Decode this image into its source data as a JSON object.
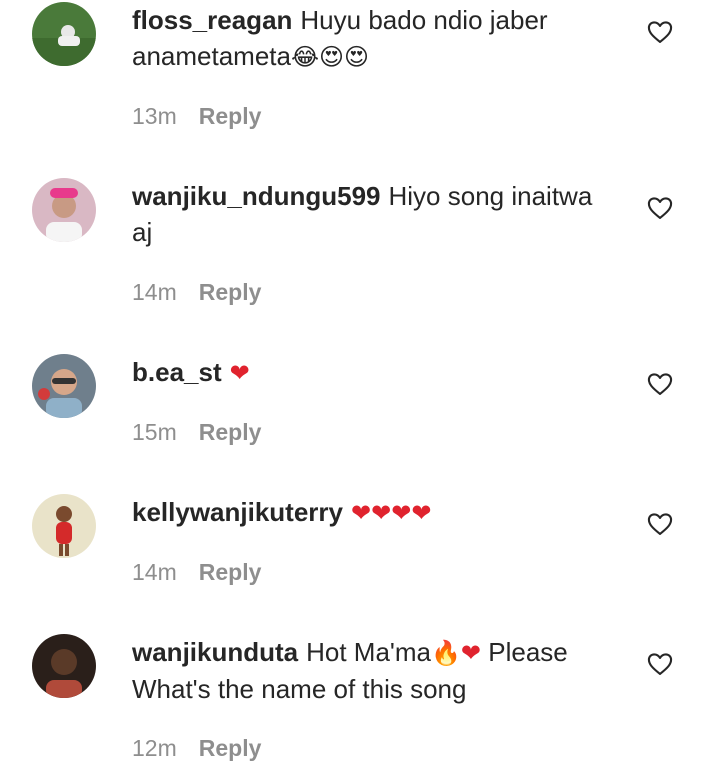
{
  "reply_label": "Reply",
  "icons": {
    "like": "heart-outline-icon"
  },
  "colors": {
    "username": "#262626",
    "meta": "#8e8e8e",
    "heart": "#e0232e"
  },
  "comments": [
    {
      "username": "floss_reagan",
      "text": "Huyu bado ndio jaber anametameta",
      "emoji": "😂😍😍",
      "time": "13m"
    },
    {
      "username": "wanjiku_ndungu599",
      "text": "Hiyo song inaitwa aj",
      "emoji": "",
      "time": "14m"
    },
    {
      "username": "b.ea_st",
      "text": "",
      "emoji": "❤",
      "time": "15m"
    },
    {
      "username": "kellywanjikuterry",
      "text": "",
      "emoji": "❤❤❤❤",
      "time": "14m"
    },
    {
      "username": "wanjikunduta",
      "text_before": "Hot Ma'ma",
      "emoji": "🔥❤",
      "text_after": "Please What's the name of this song",
      "time": "12m"
    }
  ]
}
